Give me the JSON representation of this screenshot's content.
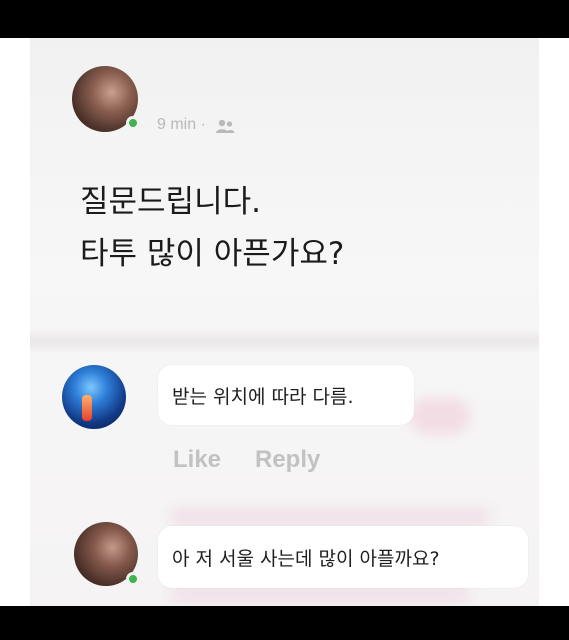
{
  "post": {
    "time": "9 min",
    "separator": "·",
    "audience_icon": "friends-icon",
    "text_lines": [
      "질문드립니다.",
      "타투 많이 아픈가요?"
    ]
  },
  "comments": [
    {
      "avatar": "spine-xray-avatar",
      "text": "받는 위치에 따라 다름.",
      "actions": {
        "like_label": "Like",
        "reply_label": "Reply"
      }
    },
    {
      "avatar": "person-avatar",
      "online": true,
      "text": "아 저 서울 사는데 많이 아플까요?"
    }
  ],
  "colors": {
    "online": "#3fb34f",
    "muted_text": "#c2c2c2",
    "primary_text": "#1b1b1b",
    "bubble_bg": "#ffffff"
  }
}
